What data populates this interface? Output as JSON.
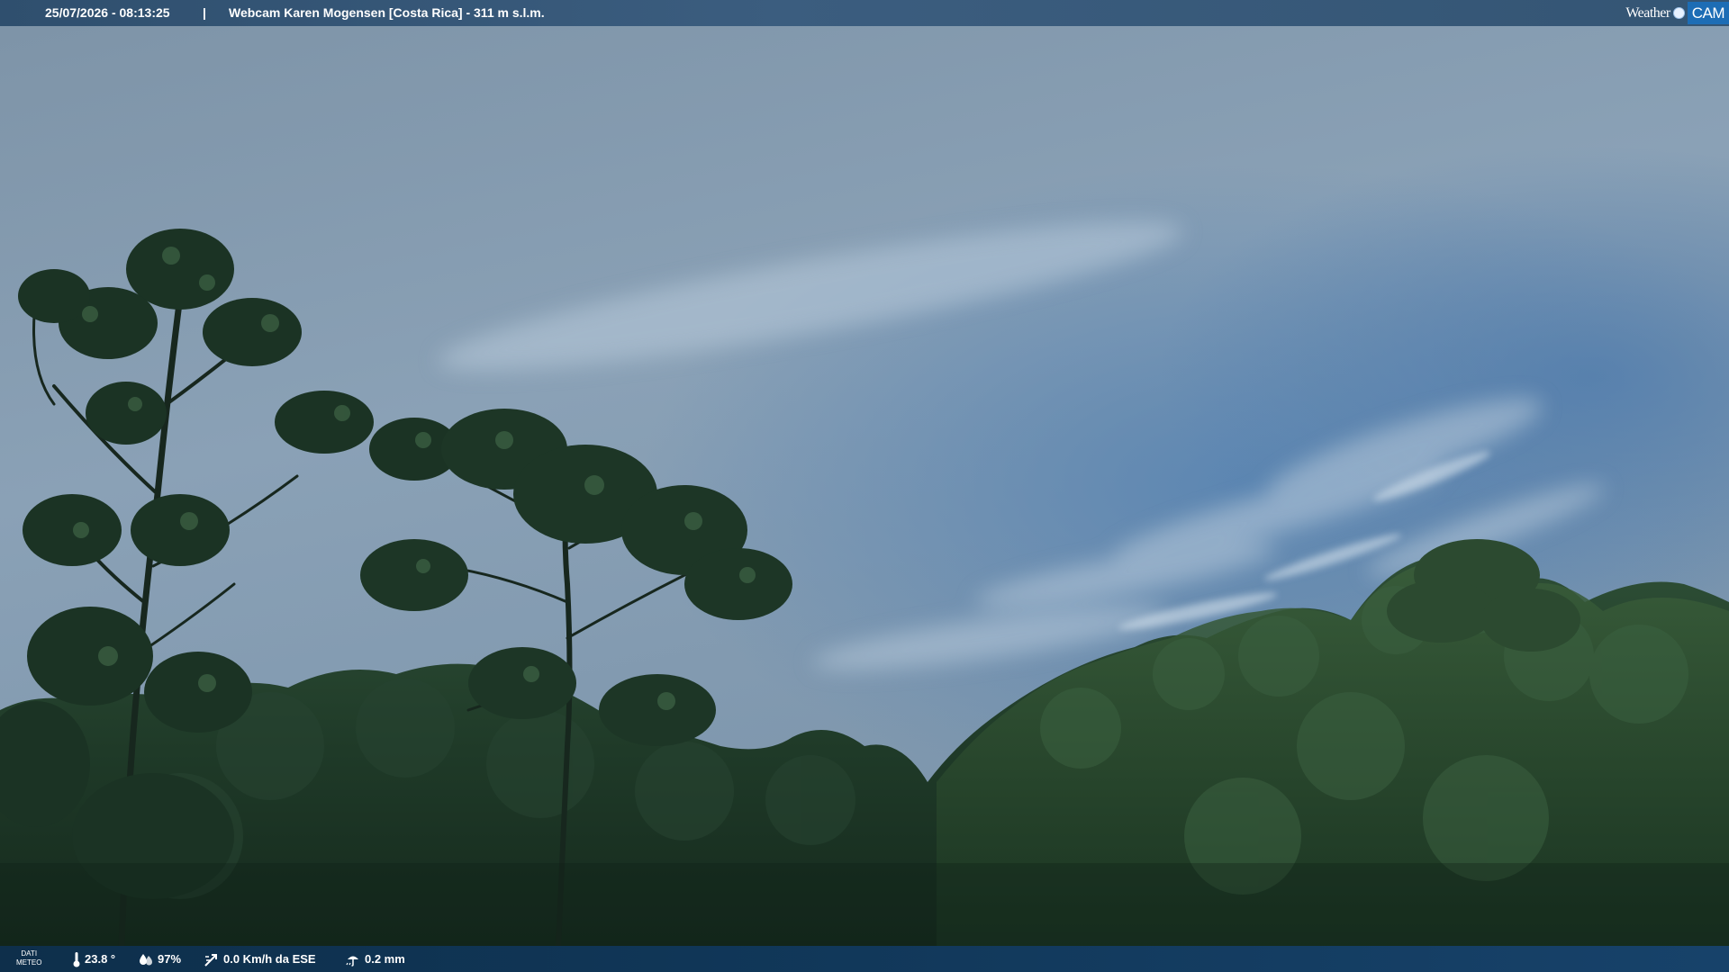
{
  "header": {
    "datetime": "25/07/2026 - 08:13:25",
    "separator": "|",
    "title": "Webcam Karen Mogensen [Costa Rica]  - 311 m s.l.m.",
    "logo_weather": "Weather",
    "logo_cam": "CAM"
  },
  "footer": {
    "label_line1": "DATI",
    "label_line2": "METEO",
    "temperature": "23.8 °",
    "humidity": "97%",
    "wind": "0.0 Km/h da ESE",
    "rain": "0.2 mm"
  },
  "colors": {
    "sky_top": "#7f96ab",
    "sky_mid": "#8aa2b8",
    "sky_blue": "#5d87b3",
    "forest_dark": "#14261c",
    "forest_mid": "#2a4a32",
    "logo_accent": "#1d6db5"
  },
  "icons": {
    "temperature": "thermometer-icon",
    "humidity": "humidity-drop-icon",
    "wind": "wind-icon",
    "rain": "rain-gauge-icon"
  }
}
